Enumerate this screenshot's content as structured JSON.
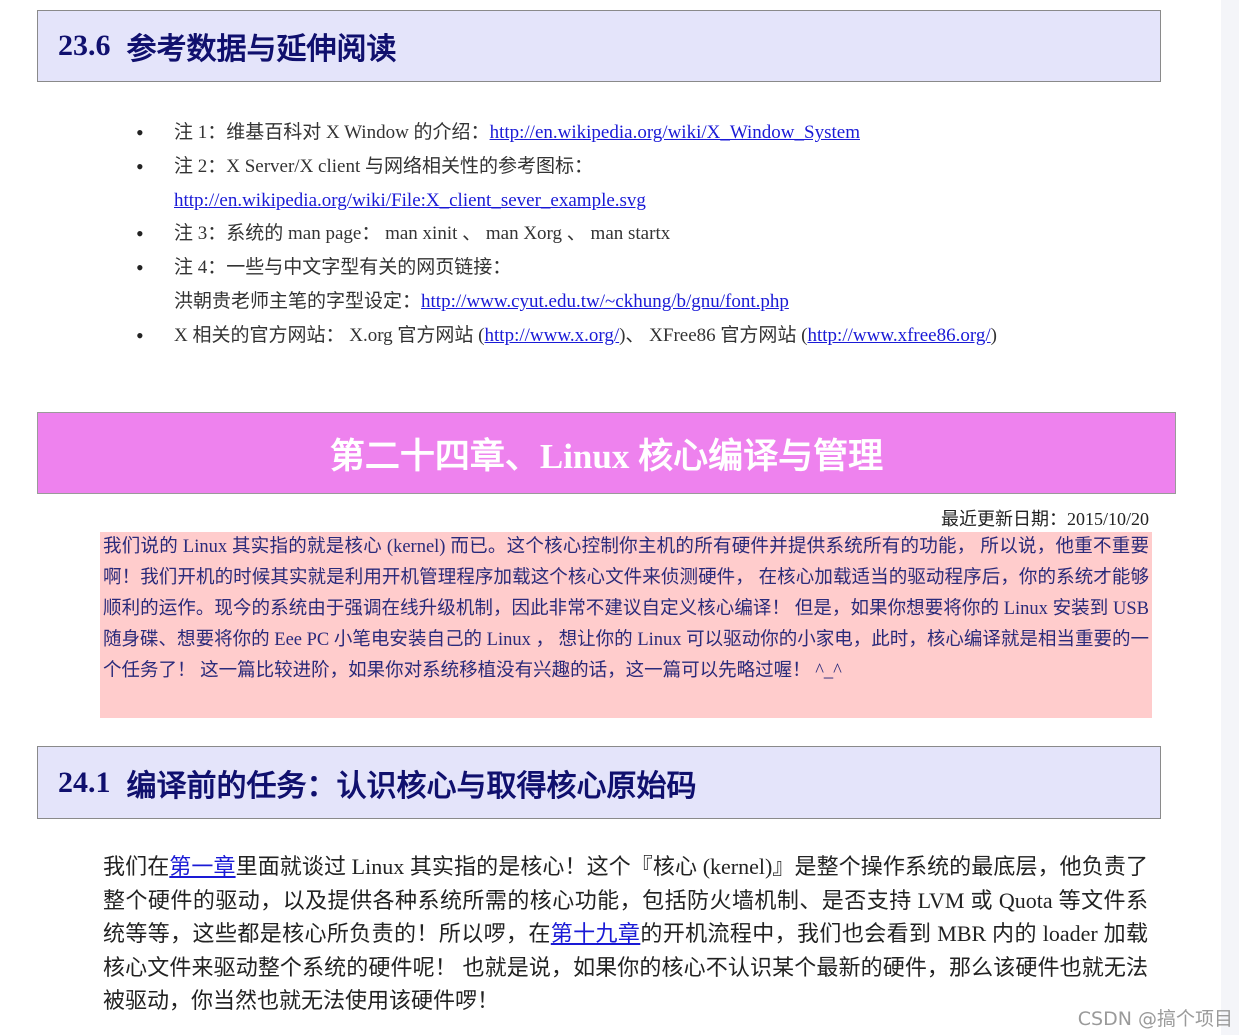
{
  "section_23_6": {
    "number": "23.6",
    "title": "参考数据与延伸阅读"
  },
  "notes": [
    {
      "text": "注 1：维基百科对 X Window 的介绍：",
      "link": "http://en.wikipedia.org/wiki/X_Window_System",
      "after": ""
    },
    {
      "text": "注 2：X Server/X client 与网络相关性的参考图标：",
      "link_line": "http://en.wikipedia.org/wiki/File:X_client_sever_example.svg"
    },
    {
      "text": "注 3：系统的 man page： man xinit 、 man Xorg 、 man startx"
    },
    {
      "text": "注 4：一些与中文字型有关的网页链接：",
      "line2_prefix": "洪朝贵老师主笔的字型设定：",
      "link": "http://www.cyut.edu.tw/~ckhung/b/gnu/font.php"
    },
    {
      "prefix": "X 相关的官方网站： X.org 官方网站 (",
      "link1": "http://www.x.org/",
      "middle": ")、 XFree86 官方网站 (",
      "link2": "http://www.xfree86.org/",
      "suffix": ")"
    }
  ],
  "chapter": {
    "title": "第二十四章、Linux 核心编译与管理"
  },
  "update": {
    "label": "最近更新日期：",
    "date": "2015/10/20"
  },
  "intro": "我们说的 Linux 其实指的就是核心 (kernel) 而已。这个核心控制你主机的所有硬件并提供系统所有的功能， 所以说，他重不重要啊！我们开机的时候其实就是利用开机管理程序加载这个核心文件来侦测硬件， 在核心加载适当的驱动程序后，你的系统才能够顺利的运作。现今的系统由于强调在线升级机制，因此非常不建议自定义核心编译！ 但是，如果你想要将你的 Linux 安装到 USB 随身碟、想要将你的 Eee PC 小笔电安装自己的 Linux ， 想让你的 Linux 可以驱动你的小家电，此时，核心编译就是相当重要的一个任务了！ 这一篇比较进阶，如果你对系统移植没有兴趣的话，这一篇可以先略过喔！ ^_^",
  "section_24_1": {
    "number": "24.1",
    "title": "编译前的任务：认识核心与取得核心原始码"
  },
  "body": {
    "p1": "我们在",
    "link1": "第一章",
    "p2": "里面就谈过 Linux 其实指的是核心！这个『核心 (kernel)』是整个操作系统的最底层，他负责了整个硬件的驱动，以及提供各种系统所需的核心功能，包括防火墙机制、是否支持 LVM 或 Quota 等文件系统等等，这些都是核心所负责的！所以啰，在",
    "link2": "第十九章",
    "p3": "的开机流程中，我们也会看到 MBR 内的 loader 加载核心文件来驱动整个系统的硬件呢！ 也就是说，如果你的核心不认识某个最新的硬件，那么该硬件也就无法被驱动，你当然也就无法使用该硬件啰！"
  },
  "watermark": "CSDN @搞个项目"
}
